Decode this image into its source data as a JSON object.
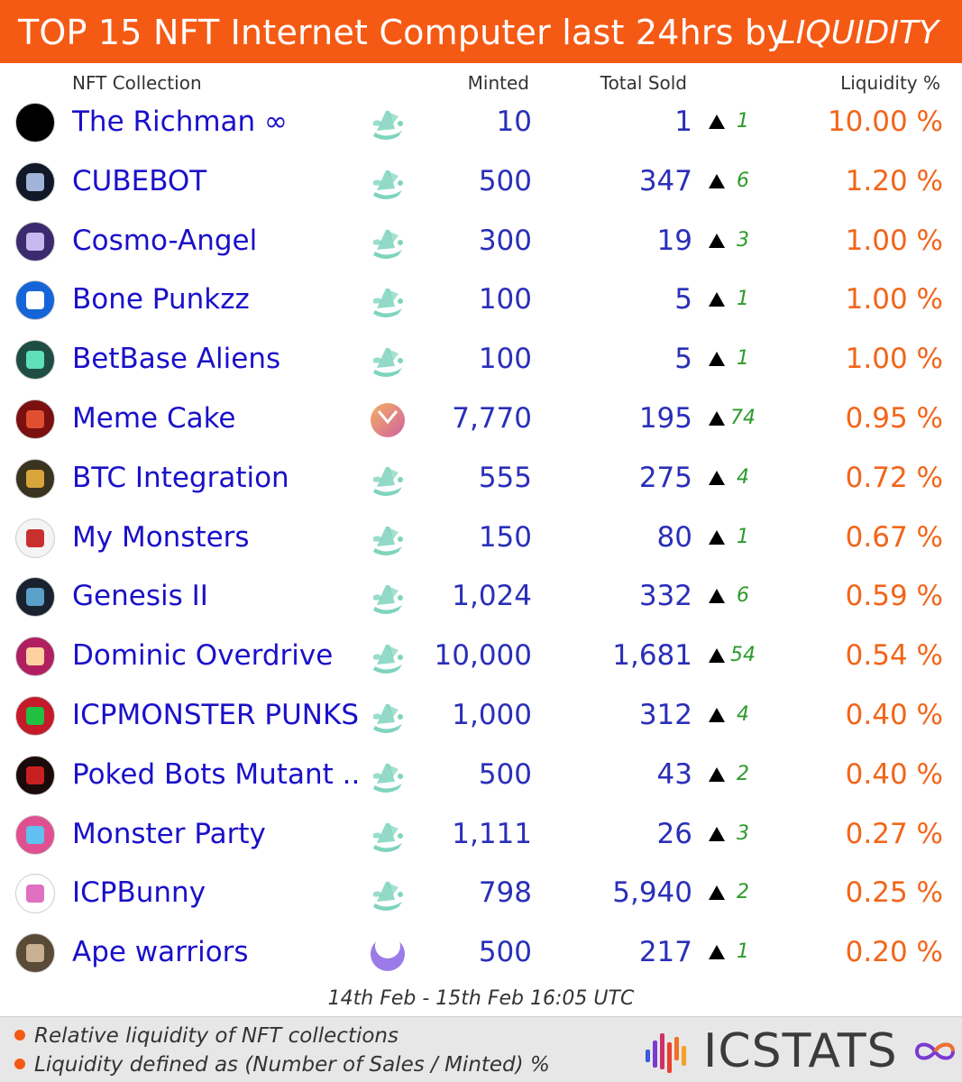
{
  "header": {
    "title": "TOP 15 NFT Internet Computer last 24hrs by",
    "metric": "LIQUIDITY",
    "bg_color": "#f55a14"
  },
  "columns": {
    "name": "NFT Collection",
    "minted": "Minted",
    "sold": "Total Sold",
    "liquidity": "Liquidity %"
  },
  "rows": [
    {
      "name": "The Richman ∞",
      "market_icon": "ship-icon",
      "minted": "10",
      "sold": "1",
      "delta": "1",
      "liquidity": "10.00 %",
      "avatar_color": "#000000",
      "avatar_accent": "#000000"
    },
    {
      "name": "CUBEBOT",
      "market_icon": "ship-icon",
      "minted": "500",
      "sold": "347",
      "delta": "6",
      "liquidity": "1.20 %",
      "avatar_color": "#111827",
      "avatar_accent": "#9fb4d8"
    },
    {
      "name": "Cosmo-Angel",
      "market_icon": "ship-icon",
      "minted": "300",
      "sold": "19",
      "delta": "3",
      "liquidity": "1.00 %",
      "avatar_color": "#3b2a6e",
      "avatar_accent": "#c9b8f0"
    },
    {
      "name": "Bone Punkzz",
      "market_icon": "ship-icon",
      "minted": "100",
      "sold": "5",
      "delta": "1",
      "liquidity": "1.00 %",
      "avatar_color": "#1565d8",
      "avatar_accent": "#ffffff"
    },
    {
      "name": "BetBase Aliens",
      "market_icon": "ship-icon",
      "minted": "100",
      "sold": "5",
      "delta": "1",
      "liquidity": "1.00 %",
      "avatar_color": "#1f4d44",
      "avatar_accent": "#5fe0b8"
    },
    {
      "name": "Meme Cake",
      "market_icon": "orange-disc-icon",
      "minted": "7,770",
      "sold": "195",
      "delta": "74",
      "liquidity": "0.95 %",
      "avatar_color": "#7a1010",
      "avatar_accent": "#e05030"
    },
    {
      "name": "BTC Integration",
      "market_icon": "ship-icon",
      "minted": "555",
      "sold": "275",
      "delta": "4",
      "liquidity": "0.72 %",
      "avatar_color": "#3a3320",
      "avatar_accent": "#d8a53a"
    },
    {
      "name": "My Monsters",
      "market_icon": "ship-icon",
      "minted": "150",
      "sold": "80",
      "delta": "1",
      "liquidity": "0.67 %",
      "avatar_color": "#f4f4f4",
      "avatar_accent": "#c83030"
    },
    {
      "name": "Genesis II",
      "market_icon": "ship-icon",
      "minted": "1,024",
      "sold": "332",
      "delta": "6",
      "liquidity": "0.59 %",
      "avatar_color": "#1a2230",
      "avatar_accent": "#5aa0c8"
    },
    {
      "name": "Dominic Overdrive",
      "market_icon": "ship-icon",
      "minted": "10,000",
      "sold": "1,681",
      "delta": "54",
      "liquidity": "0.54 %",
      "avatar_color": "#b02060",
      "avatar_accent": "#ffd0a0"
    },
    {
      "name": "ICPMONSTER PUNKS",
      "market_icon": "ship-icon",
      "minted": "1,000",
      "sold": "312",
      "delta": "4",
      "liquidity": "0.40 %",
      "avatar_color": "#c41a2a",
      "avatar_accent": "#20c040"
    },
    {
      "name": "Poked Bots Mutant ..",
      "market_icon": "ship-icon",
      "minted": "500",
      "sold": "43",
      "delta": "2",
      "liquidity": "0.40 %",
      "avatar_color": "#1a0a0a",
      "avatar_accent": "#c82020"
    },
    {
      "name": "Monster Party",
      "market_icon": "ship-icon",
      "minted": "1,111",
      "sold": "26",
      "delta": "3",
      "liquidity": "0.27 %",
      "avatar_color": "#e05090",
      "avatar_accent": "#60c0f0"
    },
    {
      "name": "ICPBunny",
      "market_icon": "ship-icon",
      "minted": "798",
      "sold": "5,940",
      "delta": "2",
      "liquidity": "0.25 %",
      "avatar_color": "#ffffff",
      "avatar_accent": "#e070c0"
    },
    {
      "name": "Ape warriors",
      "market_icon": "purple-moon-icon",
      "minted": "500",
      "sold": "217",
      "delta": "1",
      "liquidity": "0.20 %",
      "avatar_color": "#5a4a38",
      "avatar_accent": "#c8b090"
    }
  ],
  "date_range": "14th Feb - 15th Feb 16:05 UTC",
  "notes": [
    "Relative liquidity of NFT collections",
    "Liquidity defined as (Number of Sales / Minted) %"
  ],
  "brand": {
    "name": "ICSTATS",
    "logo_icon": "bars-icon",
    "infinity_icon": "infinity-icon"
  },
  "colors": {
    "name": "#1a10c9",
    "number": "#2a2fb8",
    "liquidity": "#f2651a",
    "delta": "#2c9a2c",
    "ship": "#7fd4bd"
  }
}
